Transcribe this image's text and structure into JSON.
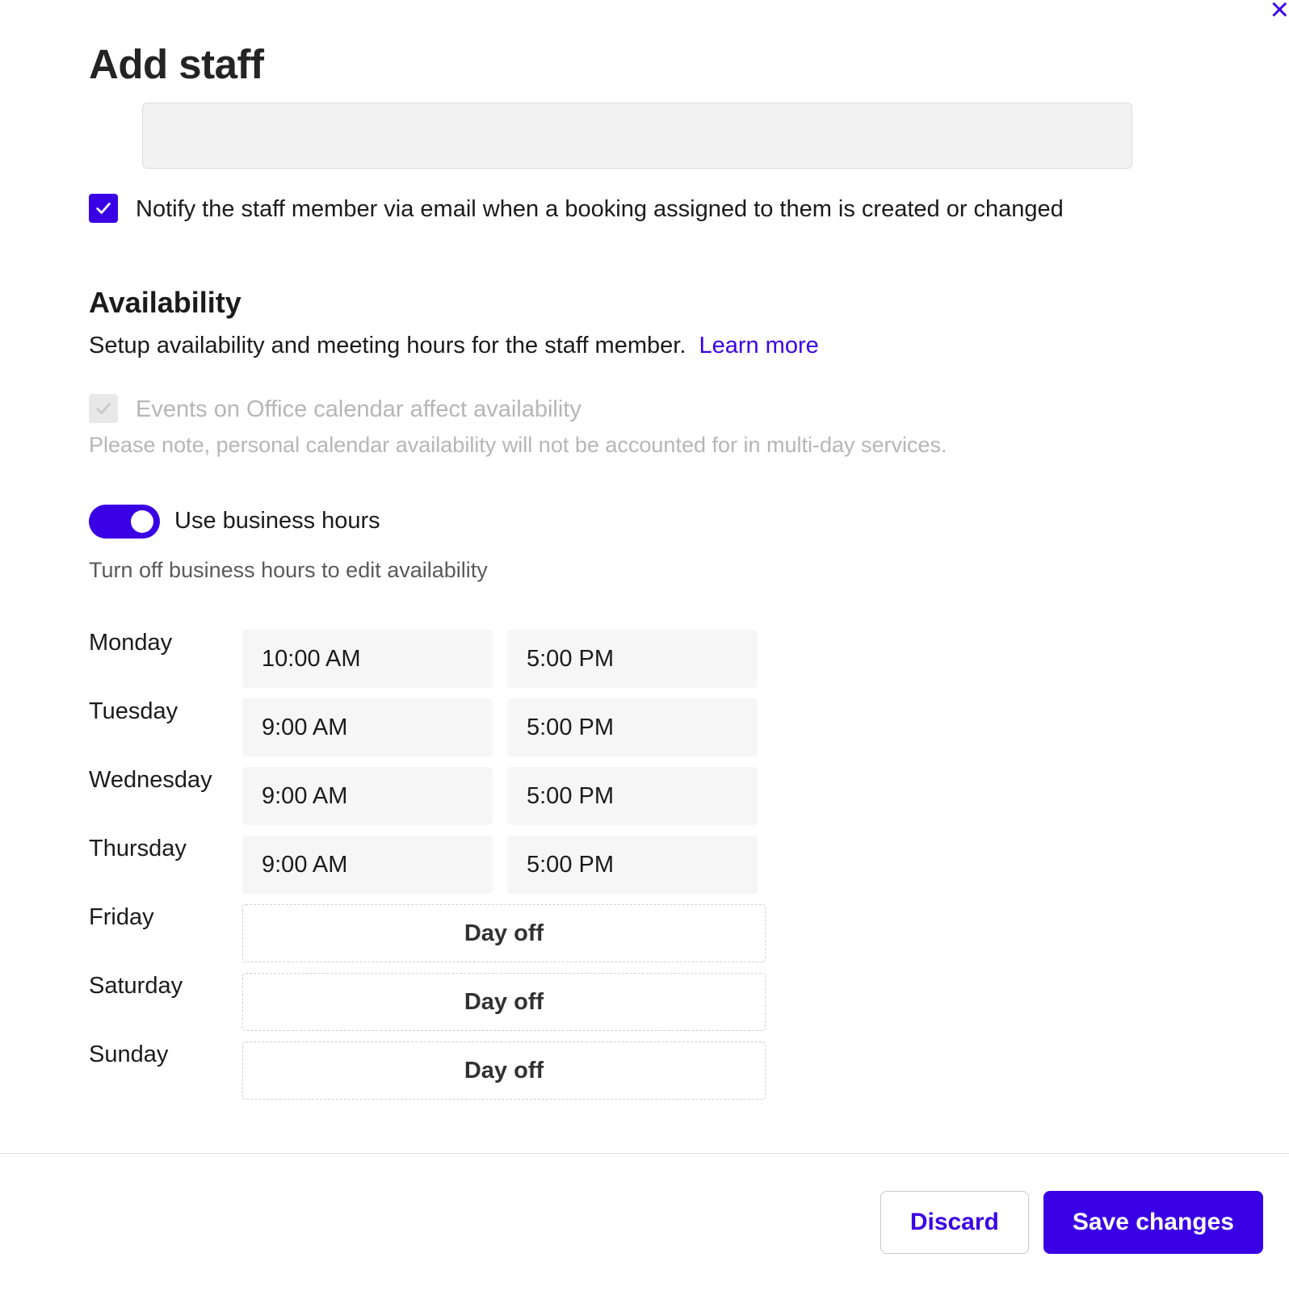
{
  "header": {
    "title": "Add staff"
  },
  "notify": {
    "checked": true,
    "label": "Notify the staff member via email when a booking assigned to them is created or changed"
  },
  "availability": {
    "title": "Availability",
    "description": "Setup availability and meeting hours for the staff member.",
    "learn_more": "Learn more",
    "office_calendar": {
      "checked": true,
      "disabled": true,
      "label": "Events on Office calendar affect availability",
      "note": "Please note, personal calendar availability will not be accounted for in multi-day services."
    },
    "use_business_hours": {
      "on": true,
      "label": "Use business hours",
      "help": "Turn off business hours to edit availability"
    },
    "schedule": [
      {
        "day": "Monday",
        "type": "hours",
        "start": "10:00 AM",
        "end": "5:00 PM"
      },
      {
        "day": "Tuesday",
        "type": "hours",
        "start": "9:00 AM",
        "end": "5:00 PM"
      },
      {
        "day": "Wednesday",
        "type": "hours",
        "start": "9:00 AM",
        "end": "5:00 PM"
      },
      {
        "day": "Thursday",
        "type": "hours",
        "start": "9:00 AM",
        "end": "5:00 PM"
      },
      {
        "day": "Friday",
        "type": "dayoff",
        "label": "Day off"
      },
      {
        "day": "Saturday",
        "type": "dayoff",
        "label": "Day off"
      },
      {
        "day": "Sunday",
        "type": "dayoff",
        "label": "Day off"
      }
    ]
  },
  "footer": {
    "discard": "Discard",
    "save": "Save changes"
  }
}
